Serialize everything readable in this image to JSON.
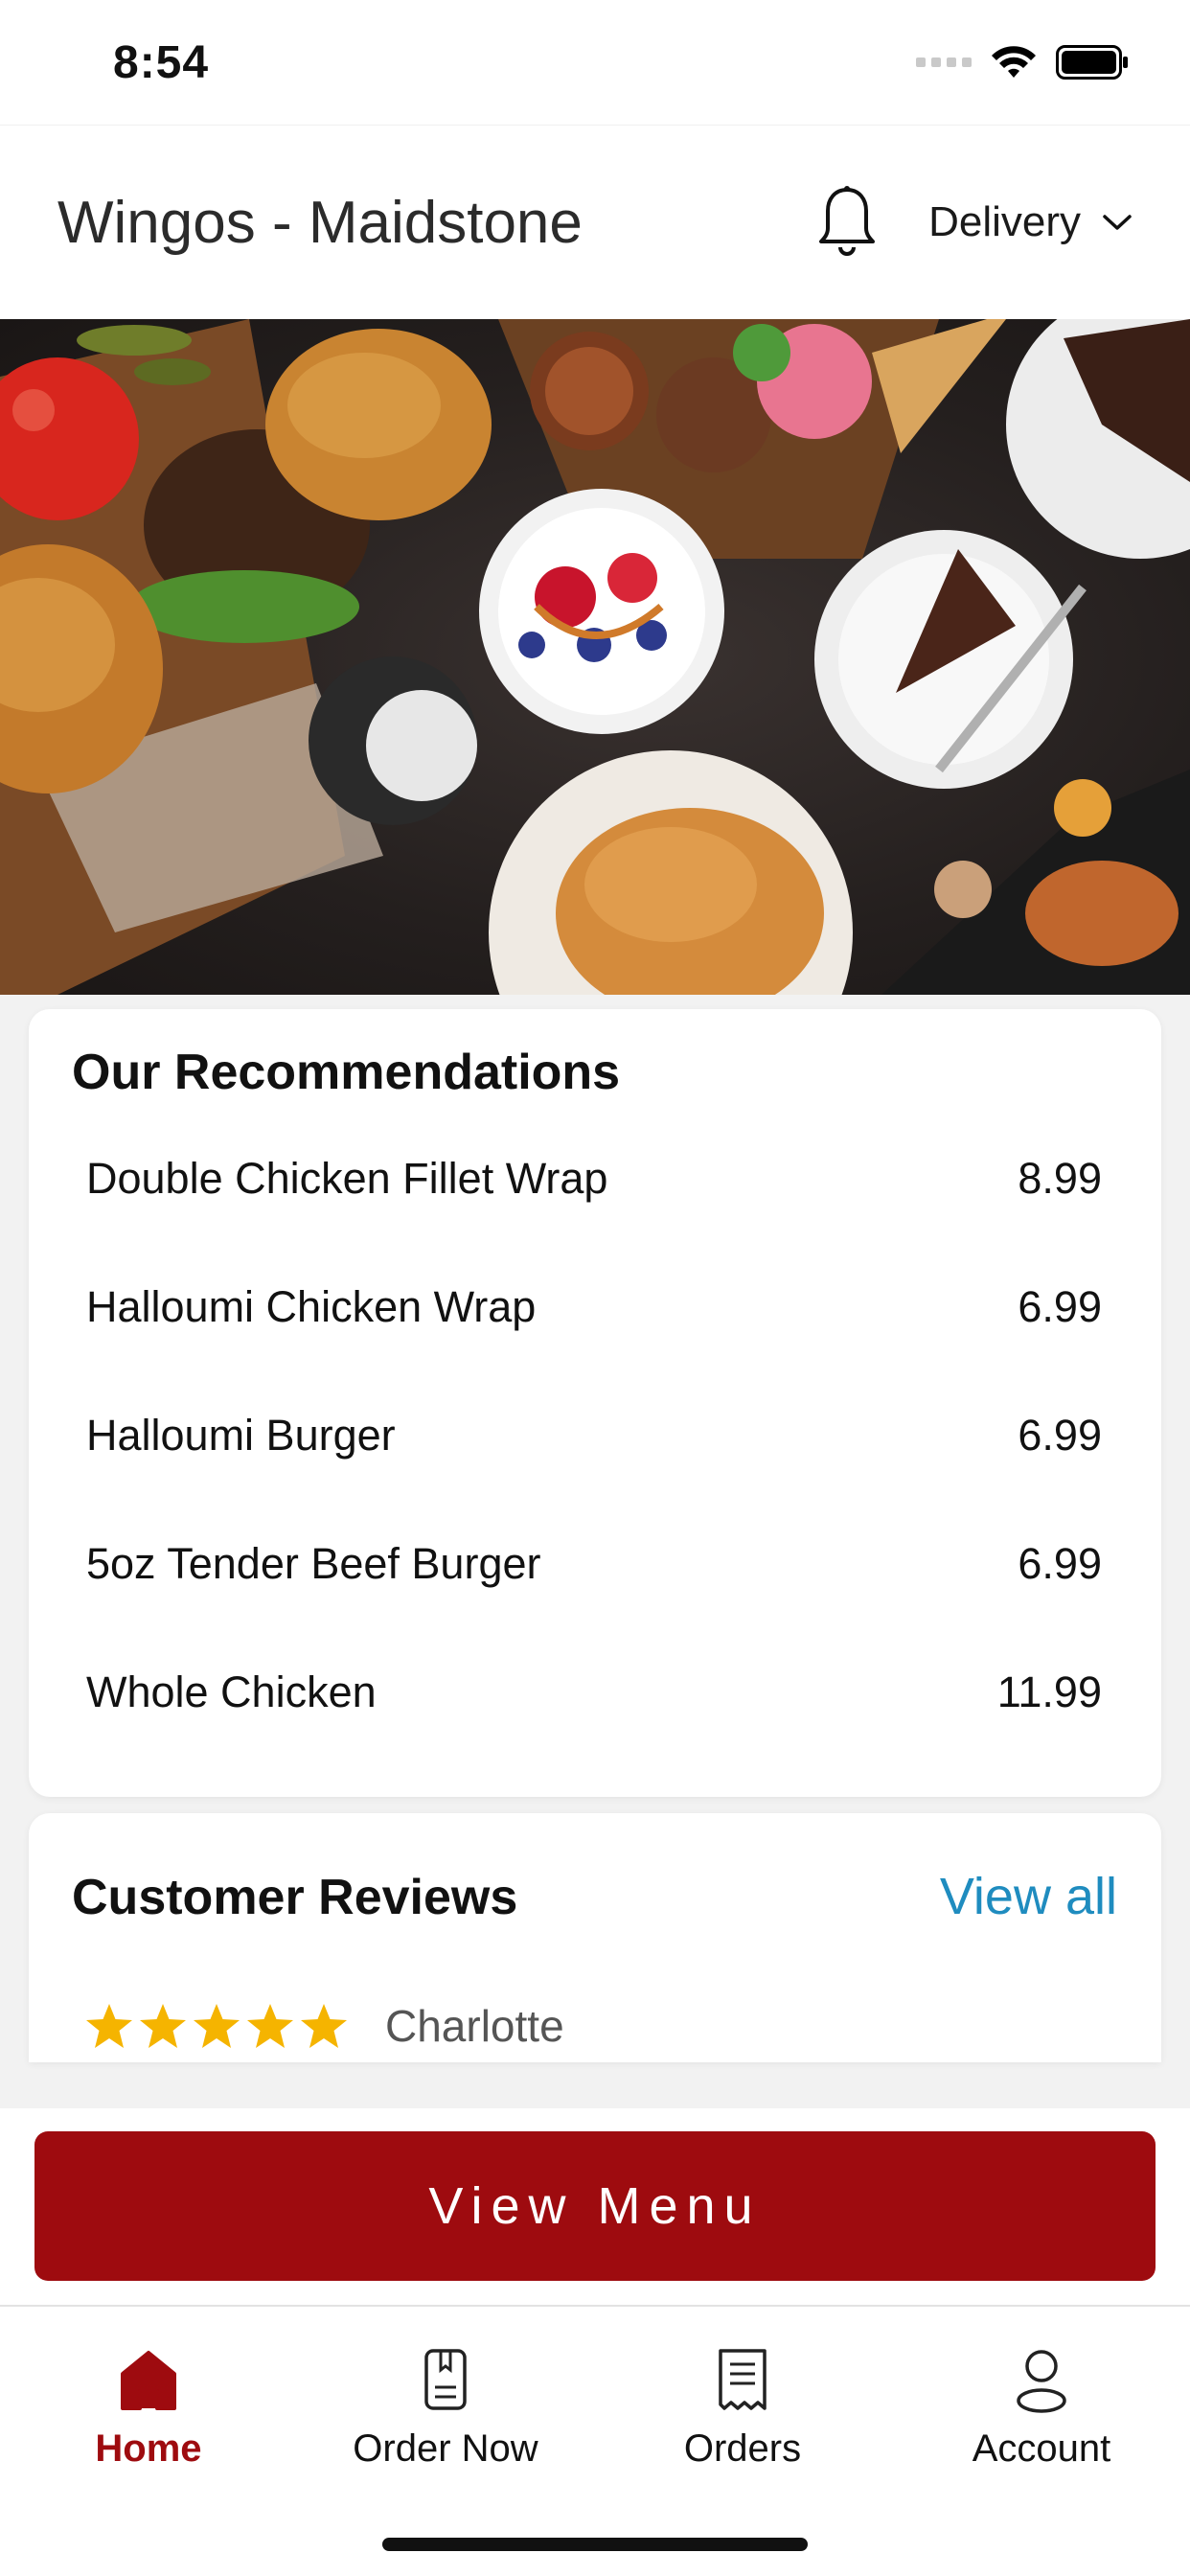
{
  "status_bar": {
    "time": "8:54"
  },
  "header": {
    "store_name": "Wingos - Maidstone",
    "notification_icon": "bell-icon",
    "order_type": "Delivery"
  },
  "recommendations": {
    "title": "Our Recommendations",
    "items": [
      {
        "name": "Double Chicken Fillet Wrap",
        "price": "8.99"
      },
      {
        "name": "Halloumi Chicken Wrap",
        "price": "6.99"
      },
      {
        "name": "Halloumi Burger",
        "price": "6.99"
      },
      {
        "name": "5oz Tender Beef Burger",
        "price": "6.99"
      },
      {
        "name": "Whole Chicken",
        "price": "11.99"
      }
    ]
  },
  "reviews": {
    "title": "Customer Reviews",
    "view_all": "View all",
    "first_review": {
      "rating": 5,
      "author": "Charlotte"
    }
  },
  "cta": {
    "label": "View Menu"
  },
  "tabs": [
    {
      "label": "Home",
      "icon": "home-icon",
      "active": true
    },
    {
      "label": "Order Now",
      "icon": "order-now-icon",
      "active": false
    },
    {
      "label": "Orders",
      "icon": "receipt-icon",
      "active": false
    },
    {
      "label": "Account",
      "icon": "account-icon",
      "active": false
    }
  ],
  "colors": {
    "brand": "#9e0b0f",
    "link": "#1f8cbf",
    "star": "#f5b400"
  }
}
